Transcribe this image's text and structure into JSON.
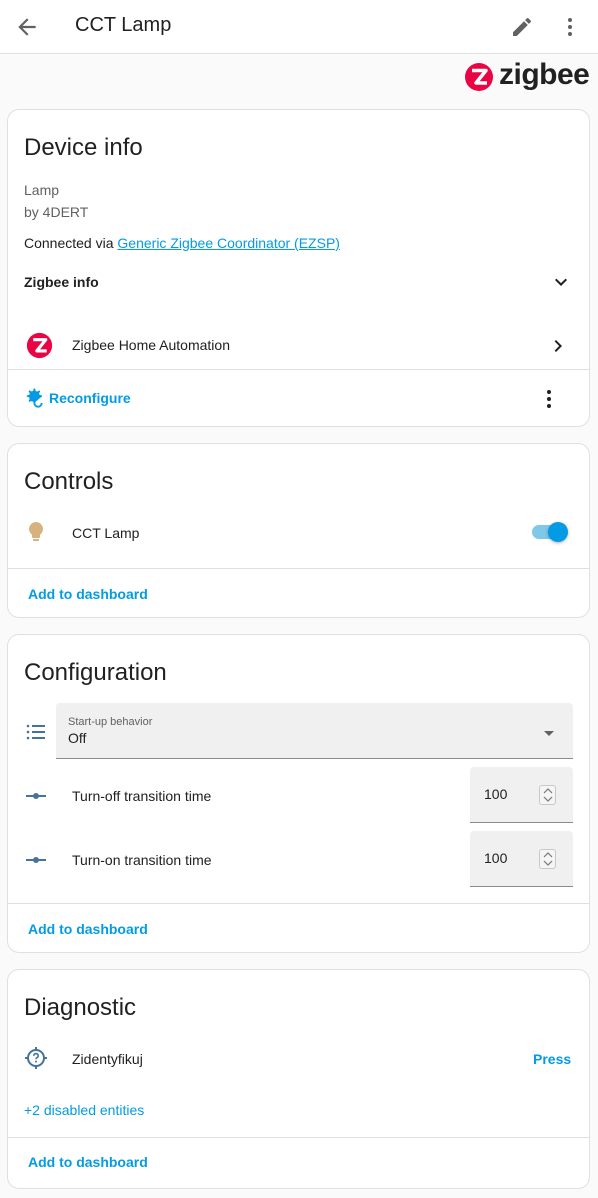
{
  "header": {
    "title": "CCT Lamp",
    "back_icon": "arrow-left-icon",
    "edit_icon": "pencil-icon",
    "more_icon": "dots-vertical-icon"
  },
  "brand": {
    "logo_text": "zigbee",
    "logo_color": "#eb0443"
  },
  "device_info": {
    "title": "Device info",
    "model": "Lamp",
    "manufacturer": "by 4DERT",
    "connected_prefix": "Connected via ",
    "connected_link": "Generic Zigbee Coordinator (EZSP)",
    "zigbee_info_label": "Zigbee info",
    "integration_label": "Zigbee Home Automation",
    "reconfigure_label": "Reconfigure"
  },
  "controls": {
    "title": "Controls",
    "entity_label": "CCT Lamp",
    "toggle_on": true,
    "add_to_dashboard": "Add to dashboard"
  },
  "configuration": {
    "title": "Configuration",
    "startup_label": "Start-up behavior",
    "startup_value": "Off",
    "turn_off_label": "Turn-off transition time",
    "turn_off_value": "100",
    "turn_on_label": "Turn-on transition time",
    "turn_on_value": "100",
    "add_to_dashboard": "Add to dashboard"
  },
  "diagnostic": {
    "title": "Diagnostic",
    "identify_label": "Zidentyfikuj",
    "press_label": "Press",
    "disabled_entities": "+2 disabled entities",
    "add_to_dashboard": "Add to dashboard"
  },
  "colors": {
    "accent": "#039be5",
    "icon_blue": "#44739e",
    "bulb": "#d8b27e"
  }
}
